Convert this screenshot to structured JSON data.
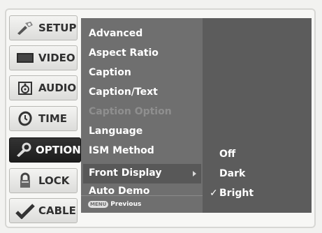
{
  "sidebar": {
    "items": [
      {
        "label": "SETUP",
        "icon": "setup-icon"
      },
      {
        "label": "VIDEO",
        "icon": "video-icon"
      },
      {
        "label": "AUDIO",
        "icon": "audio-icon"
      },
      {
        "label": "TIME",
        "icon": "time-icon"
      },
      {
        "label": "OPTION",
        "icon": "option-icon",
        "active": true
      },
      {
        "label": "LOCK",
        "icon": "lock-icon"
      },
      {
        "label": "CABLE",
        "icon": "cable-icon"
      }
    ]
  },
  "menu": {
    "items": [
      {
        "label": "Advanced"
      },
      {
        "label": "Aspect Ratio"
      },
      {
        "label": "Caption"
      },
      {
        "label": "Caption/Text"
      },
      {
        "label": "Caption Option",
        "disabled": true
      },
      {
        "label": "Language"
      },
      {
        "label": "ISM Method"
      },
      {
        "label": "Front Display",
        "selected": true
      },
      {
        "label": "Auto Demo"
      }
    ],
    "footer": {
      "key": "MENU",
      "label": "Previous"
    }
  },
  "submenu": {
    "options": [
      {
        "label": "Off",
        "mark": ""
      },
      {
        "label": "Dark",
        "mark": ""
      },
      {
        "label": "Bright",
        "mark": "✓",
        "checked": true
      }
    ]
  }
}
